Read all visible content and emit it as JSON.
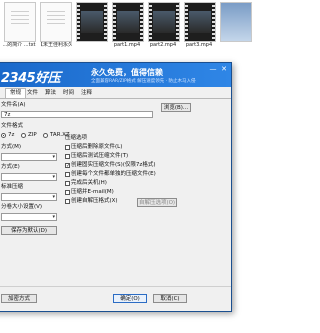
{
  "files": [
    {
      "name": "...的简介\n...txt",
      "kind": "doc"
    },
    {
      "name": "【未王佳利永久\n激活发布】txt",
      "kind": "doc"
    },
    {
      "name": "",
      "kind": "vid"
    },
    {
      "name": "part1.mp4",
      "kind": "vid"
    },
    {
      "name": "part2.mp4",
      "kind": "vid"
    },
    {
      "name": "part3.mp4",
      "kind": "vid"
    },
    {
      "name": "",
      "kind": "pic"
    }
  ],
  "banner": {
    "logo": "2345好压",
    "slogan": "永久免费，值得信赖",
    "sub": "全面兼容RAR/ZIP格式 解压速度领先 · 防止木马入侵"
  },
  "window": {
    "min": "—",
    "close": "✕",
    "title_fragment": "文件"
  },
  "tabs": [
    "常规",
    "文件",
    "算法",
    "时间",
    "注释"
  ],
  "form": {
    "archive_name_label": "文件名(A)",
    "archive_name_value": "7z",
    "browse_button": "浏览(B)...",
    "format_label": "文件格式",
    "format_options": [
      "7z",
      "ZIP",
      "TAR.XZ"
    ],
    "method_label": "方式(M)",
    "method_value": "",
    "dict_label": "方式(E)",
    "dict_value": "",
    "level_label": "标准压缩",
    "level_value": "",
    "split_label": "分卷大小设置(V)",
    "split_value": "",
    "save_settings_button": "保存为默认(D)"
  },
  "compress_options": {
    "title": "压缩选项",
    "items": [
      {
        "label": "压缩后删除原文件(L)",
        "checked": false
      },
      {
        "label": "压缩后测试压缩文件(T)",
        "checked": false
      },
      {
        "label": "创建固实压缩文件(S)(仅限7z格式)",
        "checked": true
      },
      {
        "label": "创建每个文件都单独的压缩文件(E)",
        "checked": false
      },
      {
        "label": "完成后关机(H)",
        "checked": false
      },
      {
        "label": "压缩并E-mail(M)",
        "checked": false
      },
      {
        "label": "创建自解压格式(X)",
        "checked": false
      }
    ],
    "sfx_button": "自解压选项(O)"
  },
  "footer": {
    "password_button": "加密方式",
    "ok_button": "确定(O)",
    "cancel_button": "取消(C)"
  },
  "colors": {
    "banner_start": "#1967c9",
    "banner_end": "#2f86e6",
    "accent": "#2b6cc4"
  }
}
